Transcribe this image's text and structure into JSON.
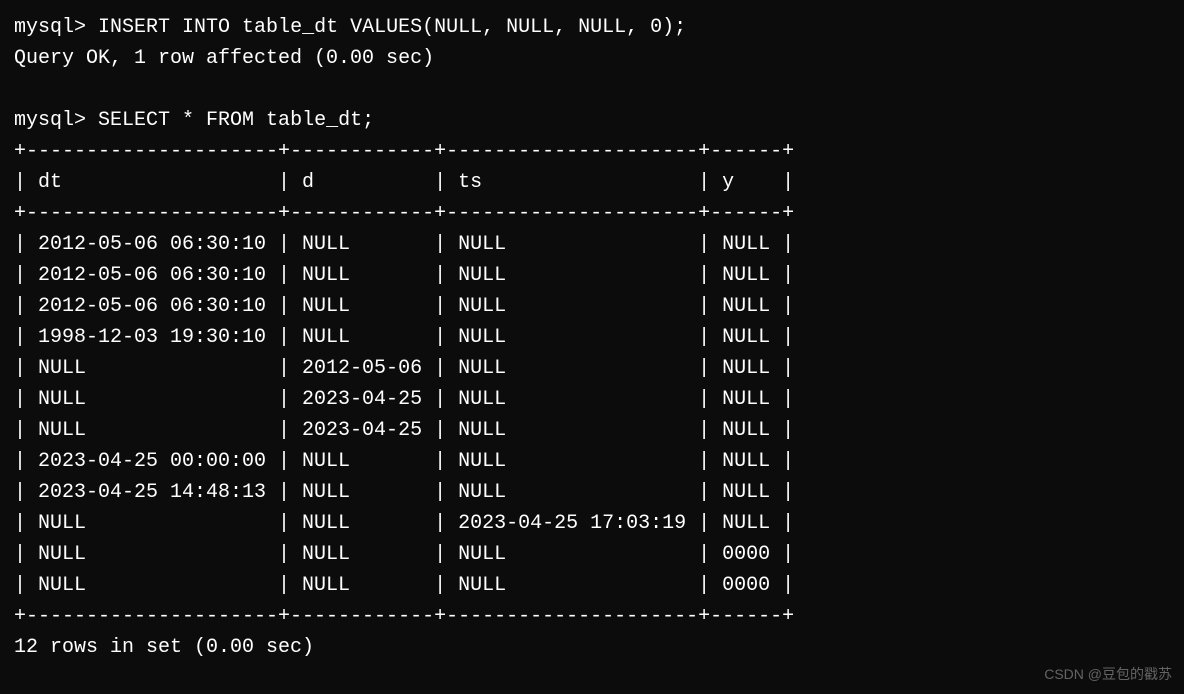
{
  "prompt": "mysql>",
  "command1": "INSERT INTO table_dt VALUES(NULL, NULL, NULL, 0);",
  "response1": "Query OK, 1 row affected (0.00 sec)",
  "command2": "SELECT * FROM table_dt;",
  "table": {
    "border_top": "+---------------------+------------+---------------------+------+",
    "header_line": "| dt                  | d          | ts                  | y    |",
    "border_mid": "+---------------------+------------+---------------------+------+",
    "rows": [
      "| 2012-05-06 06:30:10 | NULL       | NULL                | NULL |",
      "| 2012-05-06 06:30:10 | NULL       | NULL                | NULL |",
      "| 2012-05-06 06:30:10 | NULL       | NULL                | NULL |",
      "| 1998-12-03 19:30:10 | NULL       | NULL                | NULL |",
      "| NULL                | 2012-05-06 | NULL                | NULL |",
      "| NULL                | 2023-04-25 | NULL                | NULL |",
      "| NULL                | 2023-04-25 | NULL                | NULL |",
      "| 2023-04-25 00:00:00 | NULL       | NULL                | NULL |",
      "| 2023-04-25 14:48:13 | NULL       | NULL                | NULL |",
      "| NULL                | NULL       | 2023-04-25 17:03:19 | NULL |",
      "| NULL                | NULL       | NULL                | 0000 |",
      "| NULL                | NULL       | NULL                | 0000 |"
    ],
    "border_bottom": "+---------------------+------------+---------------------+------+",
    "headers": [
      "dt",
      "d",
      "ts",
      "y"
    ],
    "data": [
      {
        "dt": "2012-05-06 06:30:10",
        "d": "NULL",
        "ts": "NULL",
        "y": "NULL"
      },
      {
        "dt": "2012-05-06 06:30:10",
        "d": "NULL",
        "ts": "NULL",
        "y": "NULL"
      },
      {
        "dt": "2012-05-06 06:30:10",
        "d": "NULL",
        "ts": "NULL",
        "y": "NULL"
      },
      {
        "dt": "1998-12-03 19:30:10",
        "d": "NULL",
        "ts": "NULL",
        "y": "NULL"
      },
      {
        "dt": "NULL",
        "d": "2012-05-06",
        "ts": "NULL",
        "y": "NULL"
      },
      {
        "dt": "NULL",
        "d": "2023-04-25",
        "ts": "NULL",
        "y": "NULL"
      },
      {
        "dt": "NULL",
        "d": "2023-04-25",
        "ts": "NULL",
        "y": "NULL"
      },
      {
        "dt": "2023-04-25 00:00:00",
        "d": "NULL",
        "ts": "NULL",
        "y": "NULL"
      },
      {
        "dt": "2023-04-25 14:48:13",
        "d": "NULL",
        "ts": "NULL",
        "y": "NULL"
      },
      {
        "dt": "NULL",
        "d": "NULL",
        "ts": "2023-04-25 17:03:19",
        "y": "NULL"
      },
      {
        "dt": "NULL",
        "d": "NULL",
        "ts": "NULL",
        "y": "0000"
      },
      {
        "dt": "NULL",
        "d": "NULL",
        "ts": "NULL",
        "y": "0000"
      }
    ]
  },
  "footer": "12 rows in set (0.00 sec)",
  "watermark": "CSDN @豆包的戳苏"
}
